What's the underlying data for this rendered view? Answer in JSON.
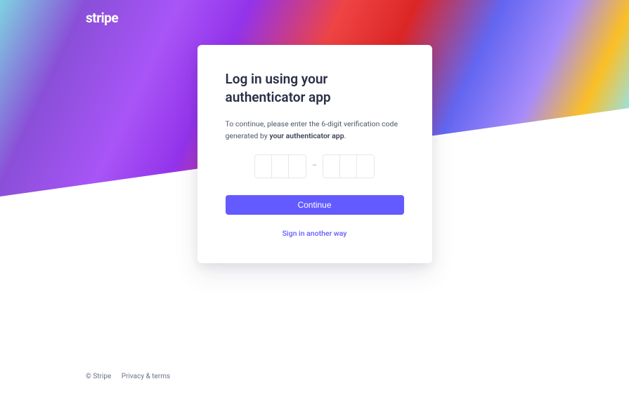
{
  "brand": "stripe",
  "card": {
    "heading": "Log in using your authenticator app",
    "instructions_prefix": "To continue, please enter the 6-digit verification code generated by ",
    "instructions_bold": "your authenticator app",
    "instructions_suffix": ".",
    "continue_label": "Continue",
    "alt_link_label": "Sign in another way"
  },
  "code": {
    "digits": [
      "",
      "",
      "",
      "",
      "",
      ""
    ],
    "separator": "–"
  },
  "footer": {
    "copyright": "© Stripe",
    "privacy_label": "Privacy & terms"
  }
}
